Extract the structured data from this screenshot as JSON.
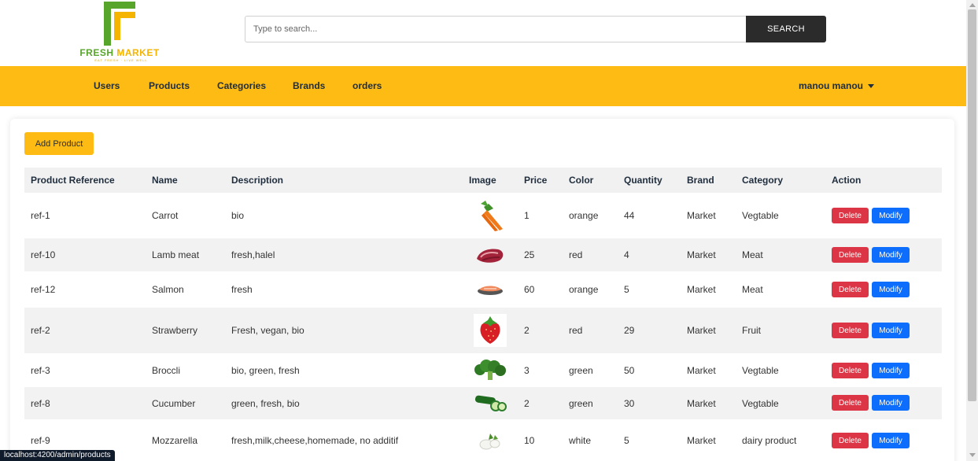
{
  "header": {
    "logo": {
      "name_part1": "FRESH ",
      "name_part2": "MARKET",
      "tagline": "EAT FRESH · LIVE WELL"
    },
    "search": {
      "placeholder": "Type to search...",
      "button_label": "SEARCH"
    }
  },
  "nav": {
    "items": [
      "Users",
      "Products",
      "Categories",
      "Brands",
      "orders"
    ],
    "user_label": "manou manou"
  },
  "toolbar": {
    "add_label": "Add Product"
  },
  "table": {
    "headers": [
      "Product Reference",
      "Name",
      "Description",
      "Image",
      "Price",
      "Color",
      "Quantity",
      "Brand",
      "Category",
      "Action"
    ],
    "rows": [
      {
        "ref": "ref-1",
        "name": "Carrot",
        "description": "bio",
        "image": "carrot-image",
        "price": "1",
        "color": "orange",
        "quantity": "44",
        "brand": "Market",
        "category": "Vegtable"
      },
      {
        "ref": "ref-10",
        "name": "Lamb meat",
        "description": "fresh,halel",
        "image": "lamb-meat-image",
        "price": "25",
        "color": "red",
        "quantity": "4",
        "brand": "Market",
        "category": "Meat"
      },
      {
        "ref": "ref-12",
        "name": "Salmon",
        "description": "fresh",
        "image": "salmon-image",
        "price": "60",
        "color": "orange",
        "quantity": "5",
        "brand": "Market",
        "category": "Meat"
      },
      {
        "ref": "ref-2",
        "name": "Strawberry",
        "description": "Fresh, vegan, bio",
        "image": "strawberry-image",
        "price": "2",
        "color": "red",
        "quantity": "29",
        "brand": "Market",
        "category": "Fruit"
      },
      {
        "ref": "ref-3",
        "name": "Broccli",
        "description": "bio, green, fresh",
        "image": "broccoli-image",
        "price": "3",
        "color": "green",
        "quantity": "50",
        "brand": "Market",
        "category": "Vegtable"
      },
      {
        "ref": "ref-8",
        "name": "Cucumber",
        "description": "green, fresh, bio",
        "image": "cucumber-image",
        "price": "2",
        "color": "green",
        "quantity": "30",
        "brand": "Market",
        "category": "Vegtable"
      },
      {
        "ref": "ref-9",
        "name": "Mozzarella",
        "description": "fresh,milk,cheese,homemade, no additif",
        "image": "mozzarella-image",
        "price": "10",
        "color": "white",
        "quantity": "5",
        "brand": "Market",
        "category": "dairy product"
      }
    ],
    "actions": {
      "delete_label": "Delete",
      "modify_label": "Modify"
    }
  },
  "status_bar": {
    "url": "localhost:4200/admin/products"
  },
  "colors": {
    "accent": "#fdbb13",
    "delete": "#dc3545",
    "modify": "#0d6efd",
    "search_button": "#2b2b2b"
  }
}
